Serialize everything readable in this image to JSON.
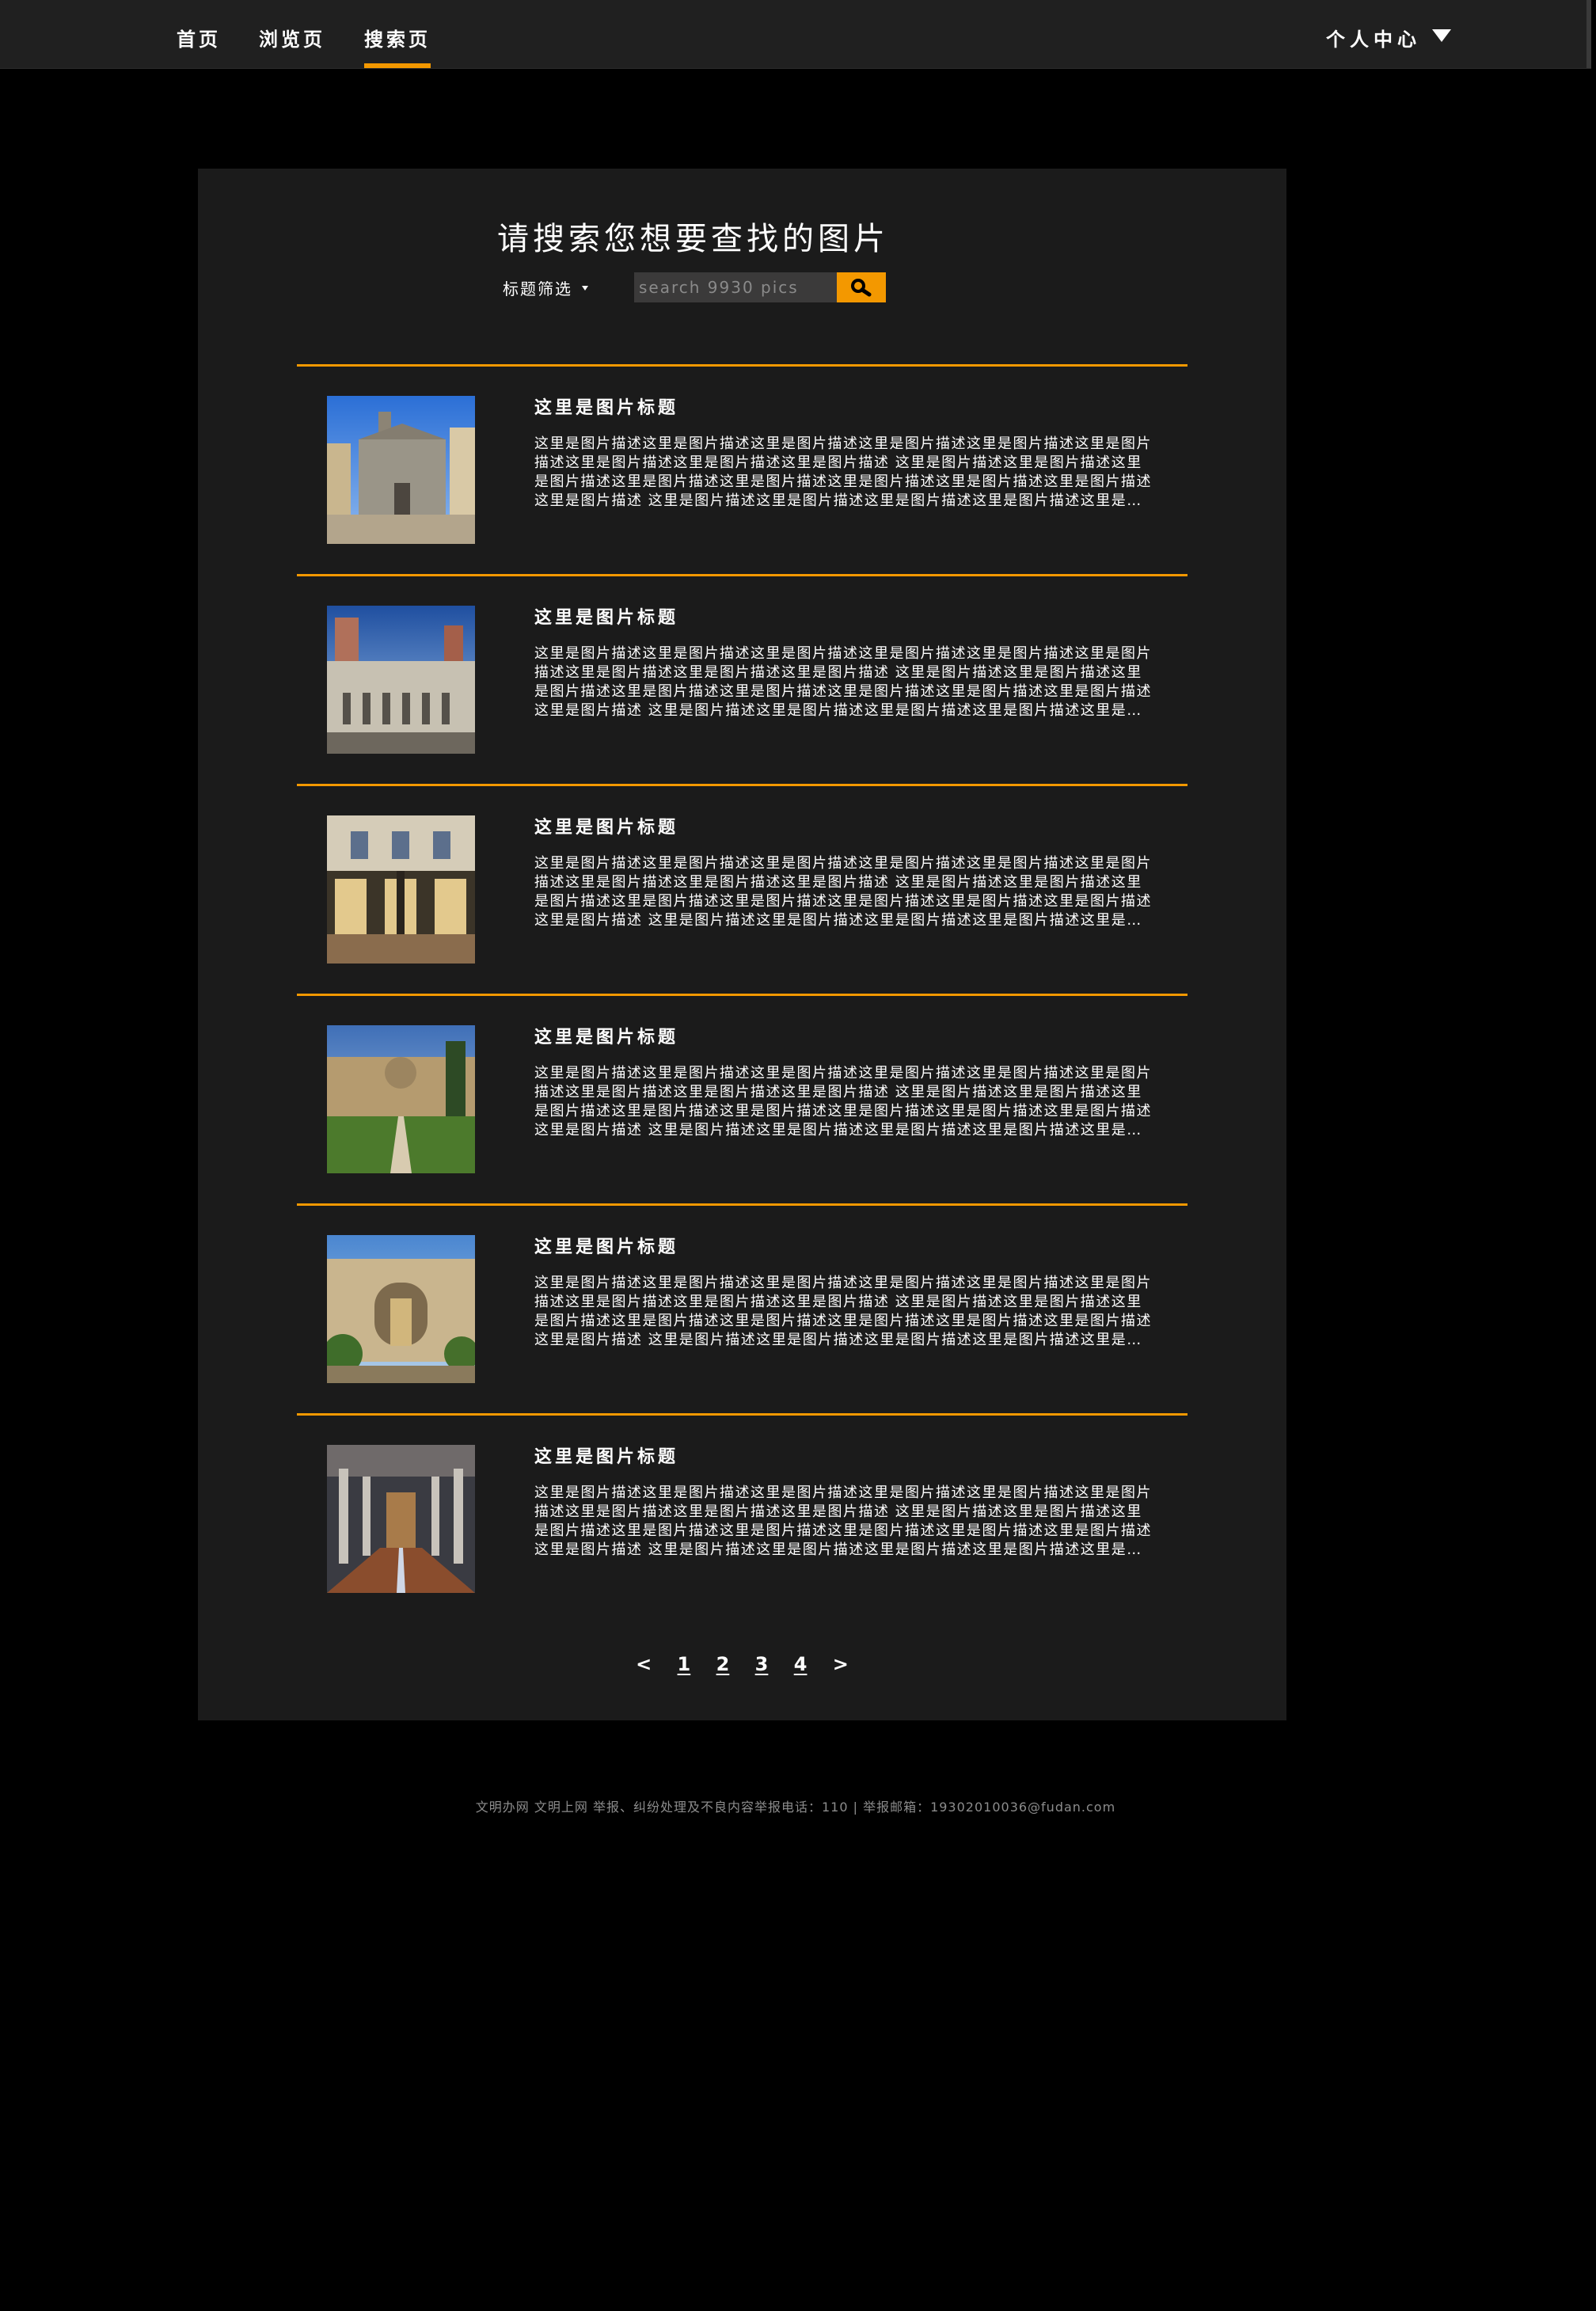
{
  "nav": {
    "items": [
      {
        "label": "首页",
        "active": false
      },
      {
        "label": "浏览页",
        "active": false
      },
      {
        "label": "搜索页",
        "active": true
      }
    ],
    "user_center": "个人中心",
    "accent": "#f39800"
  },
  "search": {
    "title": "请搜索您想要查找的图片",
    "filter_label": "标题筛选",
    "placeholder": "search 9930 pics",
    "button_icon": "search-icon"
  },
  "results": [
    {
      "title": "这里是图片标题",
      "description": "这里是图片描述这里是图片描述这里是图片描述这里是图片描述这里是图片描述这里是图片描述这里是图片描述这里是图片描述这里是图片描述 这里是图片描述这里是图片描述这里是图片描述这里是图片描述这里是图片描述这里是图片描述这里是图片描述这里是图片描述这里是图片描述 这里是图片描述这里是图片描述这里是图片描述这里是图片描述这里是图片描述",
      "image": "cathedral-facade"
    },
    {
      "title": "这里是图片标题",
      "description": "这里是图片描述这里是图片描述这里是图片描述这里是图片描述这里是图片描述这里是图片描述这里是图片描述这里是图片描述这里是图片描述 这里是图片描述这里是图片描述这里是图片描述这里是图片描述这里是图片描述这里是图片描述这里是图片描述这里是图片描述这里是图片描述 这里是图片描述这里是图片描述这里是图片描述这里是图片描述这里是图片描述",
      "image": "romanesque-church"
    },
    {
      "title": "这里是图片标题",
      "description": "这里是图片描述这里是图片描述这里是图片描述这里是图片描述这里是图片描述这里是图片描述这里是图片描述这里是图片描述这里是图片描述 这里是图片描述这里是图片描述这里是图片描述这里是图片描述这里是图片描述这里是图片描述这里是图片描述这里是图片描述这里是图片描述 这里是图片描述这里是图片描述这里是图片描述这里是图片描述这里是图片描述",
      "image": "palazzo-courtyard"
    },
    {
      "title": "这里是图片标题",
      "description": "这里是图片描述这里是图片描述这里是图片描述这里是图片描述这里是图片描述这里是图片描述这里是图片描述这里是图片描述这里是图片描述 这里是图片描述这里是图片描述这里是图片描述这里是图片描述这里是图片描述这里是图片描述这里是图片描述这里是图片描述这里是图片描述 这里是图片描述这里是图片描述这里是图片描述这里是图片描述这里是图片描述",
      "image": "cloister-garden"
    },
    {
      "title": "这里是图片标题",
      "description": "这里是图片描述这里是图片描述这里是图片描述这里是图片描述这里是图片描述这里是图片描述这里是图片描述这里是图片描述这里是图片描述 这里是图片描述这里是图片描述这里是图片描述这里是图片描述这里是图片描述这里是图片描述这里是图片描述这里是图片描述这里是图片描述 这里是图片描述这里是图片描述这里是图片描述这里是图片描述这里是图片描述",
      "image": "baroque-fountain"
    },
    {
      "title": "这里是图片标题",
      "description": "这里是图片描述这里是图片描述这里是图片描述这里是图片描述这里是图片描述这里是图片描述这里是图片描述这里是图片描述这里是图片描述 这里是图片描述这里是图片描述这里是图片描述这里是图片描述这里是图片描述这里是图片描述这里是图片描述这里是图片描述这里是图片描述 这里是图片描述这里是图片描述这里是图片描述这里是图片描述这里是图片描述",
      "image": "church-nave"
    }
  ],
  "pagination": {
    "prev": "<",
    "pages": [
      "1",
      "2",
      "3",
      "4"
    ],
    "next": ">"
  },
  "footer": {
    "text": "文明办网 文明上网 举报、纠纷处理及不良内容举报电话：110 | 举报邮箱：19302010036@fudan.com"
  }
}
